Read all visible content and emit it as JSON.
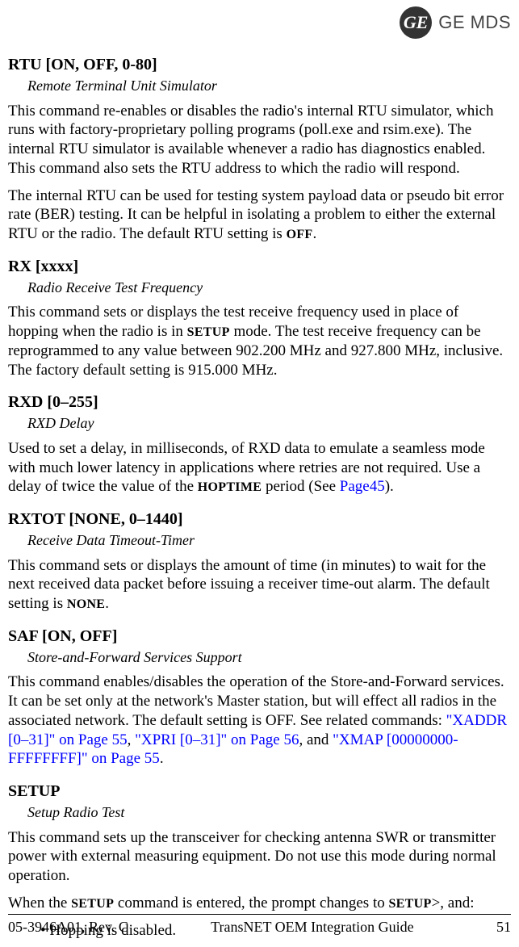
{
  "header": {
    "logo_text": "GE",
    "brand": "GE MDS"
  },
  "sections": {
    "rtu": {
      "heading": "RTU [ON, OFF, 0-80]",
      "subtitle": "Remote Terminal Unit Simulator",
      "p1_a": "This command re-enables or disables the radio's internal RTU simulator, which runs with factory-proprietary polling programs (poll.exe and rsim.exe). The internal RTU simulator is available whenever a radio has diagnostics enabled. This command also sets the RTU address to which the radio will respond.",
      "p2_a": "The internal RTU can be used for testing system payload data or pseudo bit error rate (BER) testing. It can be helpful in isolating a problem to either the external RTU or the radio. The default RTU setting is ",
      "p2_off": "OFF",
      "p2_b": "."
    },
    "rx": {
      "heading": "RX [xxxx]",
      "subtitle": "Radio Receive Test Frequency",
      "p1_a": "This command sets or displays the test receive frequency used in place of hopping when the radio is in ",
      "p1_setup": "SETUP",
      "p1_b": " mode. The test receive frequency can be reprogrammed to any value between 902.200 MHz and 927.800 MHz, inclusive. The factory default setting is 915.000 MHz."
    },
    "rxd": {
      "heading": "RXD [0–255]",
      "subtitle": "RXD Delay",
      "p1_a": "Used to set a delay, in milliseconds, of RXD data to emulate a seamless mode with much lower latency in applications where retries are not required. Use a delay of twice the value of the ",
      "p1_hoptime": "HOPTIME",
      "p1_b": " period (See ",
      "p1_link": "Page45",
      "p1_c": ")."
    },
    "rxtot": {
      "heading": "RXTOT [NONE, 0–1440]",
      "subtitle": "Receive Data Timeout-Timer",
      "p1_a": "This command sets or displays the amount of time (in minutes) to wait for the next received data packet before issuing a receiver time-out alarm. The default setting is ",
      "p1_none": "NONE",
      "p1_b": "."
    },
    "saf": {
      "heading": "SAF [ON, OFF]",
      "subtitle": "Store-and-Forward Services Support",
      "p1_a": "This command enables/disables the operation of the Store-and-Forward services. It can be set only at the network's Master station, but will effect all radios in the associated network. The default setting is OFF. See related commands: ",
      "p1_link1": "\"XADDR [0–31]\" on Page 55",
      "p1_sep1": ", ",
      "p1_link2": "\"XPRI [0–31]\" on Page 56",
      "p1_sep2": ", and ",
      "p1_link3": "\"XMAP [00000000-FFFFFFFF]\" on Page 55",
      "p1_b": "."
    },
    "setup": {
      "heading": "SETUP",
      "subtitle": "Setup Radio Test",
      "p1_a": "This command sets up the transceiver for checking antenna SWR or transmitter power with external measuring equipment. Do not use this mode during normal operation.",
      "p2_a": "When the ",
      "p2_setup1": "SETUP",
      "p2_b": " command is entered, the prompt changes to ",
      "p2_setup2": "SETUP",
      "p2_c": ">, and:",
      "bullet1": "Hopping is disabled."
    }
  },
  "footer": {
    "left": "05-3946A01, Rev. C",
    "center": "TransNET OEM Integration Guide",
    "right": "51"
  }
}
